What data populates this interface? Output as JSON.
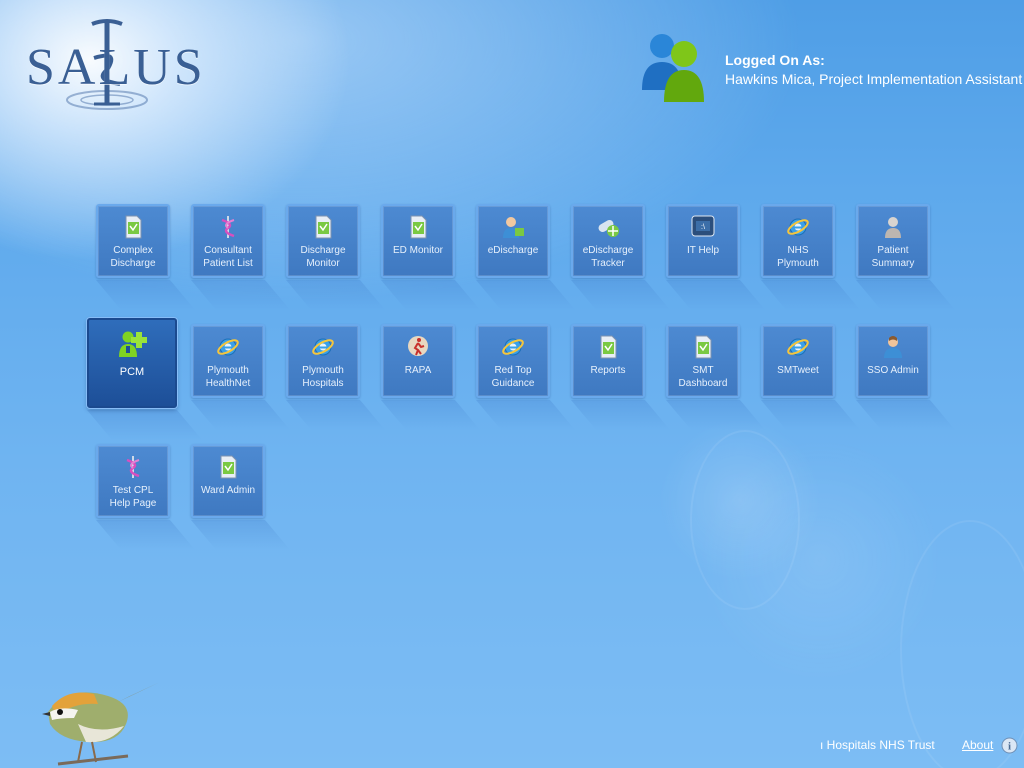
{
  "app": {
    "logo_text": "SALUS"
  },
  "user": {
    "label": "Logged On As:",
    "name": "Hawkins Mica, Project Implementation Assistant"
  },
  "tiles": [
    {
      "label": "Complex\nDischarge",
      "icon": "document-icon"
    },
    {
      "label": "Consultant\nPatient List",
      "icon": "caduceus-icon"
    },
    {
      "label": "Discharge\nMonitor",
      "icon": "document-icon"
    },
    {
      "label": "ED Monitor",
      "icon": "document-icon"
    },
    {
      "label": "eDischarge",
      "icon": "person-icon"
    },
    {
      "label": "eDischarge\nTracker",
      "icon": "pill-icon"
    },
    {
      "label": "IT Help",
      "icon": "monitor-icon"
    },
    {
      "label": "NHS\nPlymouth",
      "icon": "internet-explorer-icon"
    },
    {
      "label": "Patient\nSummary",
      "icon": "patient-icon"
    },
    {
      "label": "PCM",
      "icon": "add-user-icon",
      "selected": true
    },
    {
      "label": "Plymouth\nHealthNet",
      "icon": "internet-explorer-icon"
    },
    {
      "label": "Plymouth\nHospitals",
      "icon": "internet-explorer-icon"
    },
    {
      "label": "RAPA",
      "icon": "runner-icon"
    },
    {
      "label": "Red Top\nGuidance",
      "icon": "internet-explorer-icon"
    },
    {
      "label": "Reports",
      "icon": "document-icon"
    },
    {
      "label": "SMT\nDashboard",
      "icon": "document-icon"
    },
    {
      "label": "SMTweet",
      "icon": "internet-explorer-icon"
    },
    {
      "label": "SSO Admin",
      "icon": "user-icon"
    },
    {
      "label": "Test CPL\nHelp Page",
      "icon": "caduceus-icon"
    },
    {
      "label": "Ward Admin",
      "icon": "document-icon"
    }
  ],
  "footer": {
    "trust": "ı Hospitals NHS Trust",
    "about": "About"
  },
  "colors": {
    "background": "#5ea9ec",
    "tile": "#4d8ad2",
    "tile_border": "#6aa9ec",
    "selected_tile": "#1d4f98",
    "text": "#ffffff"
  }
}
